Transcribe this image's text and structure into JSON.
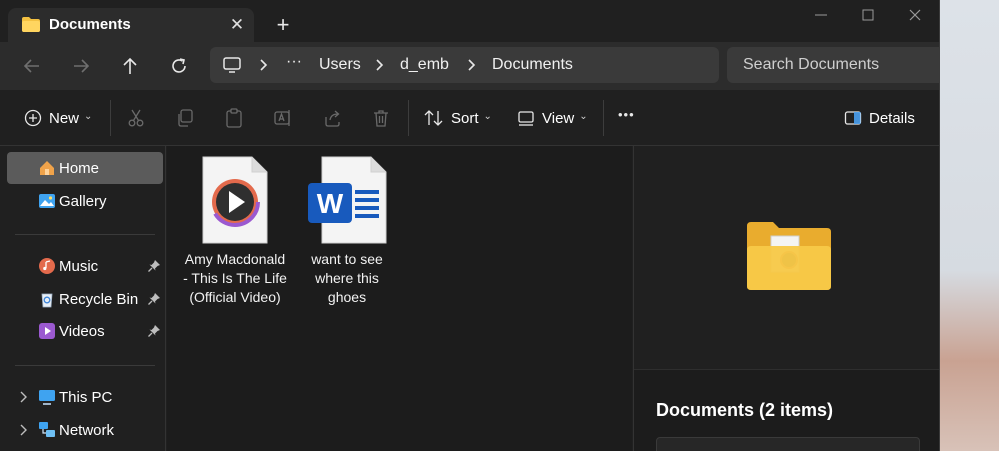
{
  "window": {
    "tab_title": "Documents",
    "close_tab_glyph": "✕",
    "new_tab_glyph": "+"
  },
  "address": {
    "ellipsis": "···",
    "path": [
      "Users",
      "d_emb",
      "Documents"
    ],
    "search_placeholder": "Search Documents"
  },
  "toolbar": {
    "new_label": "New",
    "sort_label": "Sort",
    "view_label": "View",
    "more_glyph": "•••",
    "details_label": "Details",
    "chevron_glyph": "⌄"
  },
  "sidebar": {
    "items": [
      {
        "label": "Home",
        "icon": "home-icon",
        "selected": true
      },
      {
        "label": "Gallery",
        "icon": "gallery-icon"
      },
      {
        "label": "Music",
        "icon": "music-icon",
        "pinned": true
      },
      {
        "label": "Recycle Bin",
        "icon": "recycle-bin-icon",
        "pinned": true
      },
      {
        "label": "Videos",
        "icon": "videos-icon",
        "pinned": true
      },
      {
        "label": "This PC",
        "icon": "this-pc-icon",
        "expandable": true
      },
      {
        "label": "Network",
        "icon": "network-icon",
        "expandable": true
      }
    ]
  },
  "files": [
    {
      "name": "Amy Macdonald - This Is The Life (Official Video)",
      "icon": "video-file-icon"
    },
    {
      "name": "want to see where this ghoes",
      "icon": "word-document-icon"
    }
  ],
  "details": {
    "title": "Documents (2 items)"
  },
  "colors": {
    "window_bg": "#202020",
    "content_bg": "#1c1c1c",
    "selected_bg": "#5b5b5b",
    "word_blue": "#185abd",
    "folder_yellow": "#f7c948"
  }
}
